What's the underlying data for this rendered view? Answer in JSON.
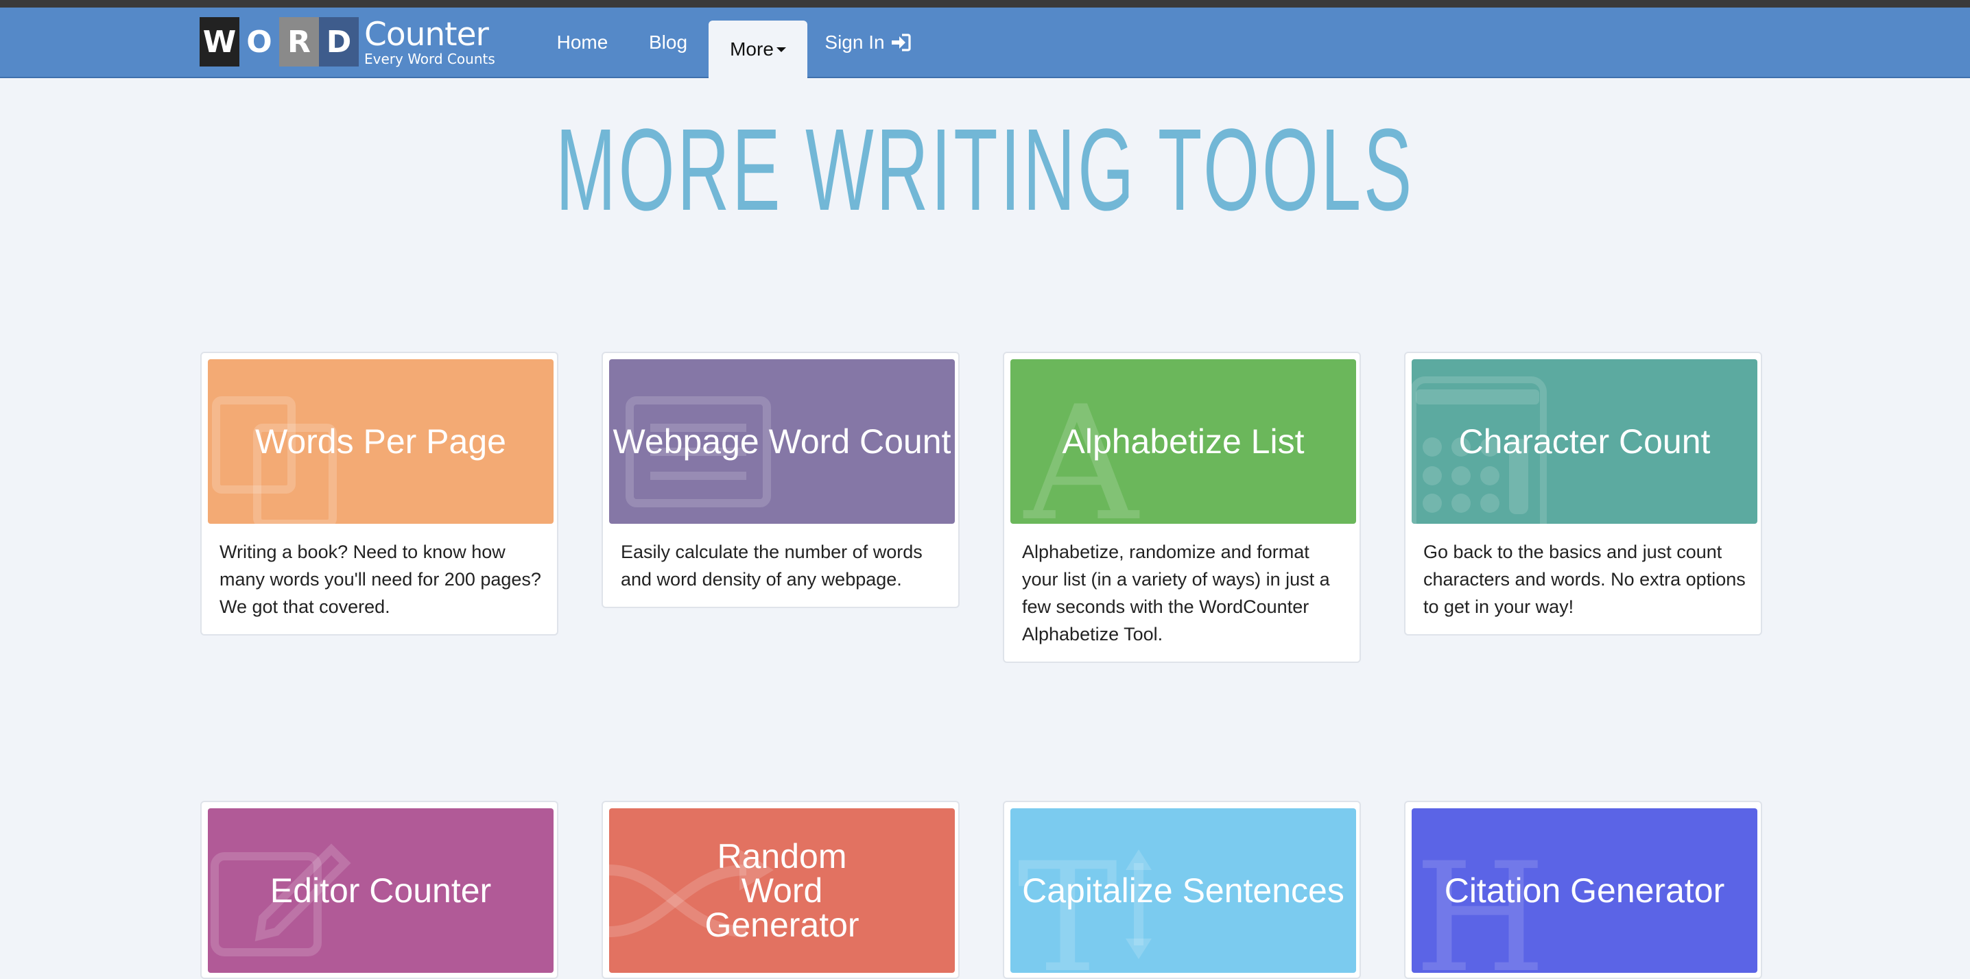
{
  "logo": {
    "letters": [
      "W",
      "O",
      "R",
      "D"
    ],
    "brand": "Counter",
    "tagline": "Every Word Counts"
  },
  "nav": {
    "home": "Home",
    "blog": "Blog",
    "more": "More",
    "signin": "Sign In"
  },
  "page_title": "MORE WRITING TOOLS",
  "cards": [
    {
      "title": "Words Per Page",
      "desc": "Writing a book? Need to know how many words you'll need for 200 pages? We got that covered.",
      "color": "#f3aa74",
      "icon": "pages-icon"
    },
    {
      "title": "Webpage Word Count",
      "desc": "Easily calculate the number of words and word density of any webpage.",
      "color": "#8577a6",
      "icon": "newspaper-icon"
    },
    {
      "title": "Alphabetize List",
      "desc": "Alphabetize, randomize and format your list (in a variety of ways) in just a few seconds with the WordCounter Alphabetize Tool.",
      "color": "#6bb75b",
      "icon": "letter-a-icon"
    },
    {
      "title": "Character Count",
      "desc": "Go back to the basics and just count characters and words. No extra options to get in your way!",
      "color": "#5caaa0",
      "icon": "calculator-icon"
    },
    {
      "title": "Editor Counter",
      "desc": "",
      "color": "#b15a97",
      "icon": "edit-icon"
    },
    {
      "title": "Random Word Generator",
      "desc": "",
      "color": "#e27261",
      "icon": "shuffle-icon"
    },
    {
      "title": "Capitalize Sentences",
      "desc": "",
      "color": "#7bcbef",
      "icon": "text-height-icon"
    },
    {
      "title": "Citation Generator",
      "desc": "",
      "color": "#5b64e6",
      "icon": "letter-h-icon"
    }
  ]
}
